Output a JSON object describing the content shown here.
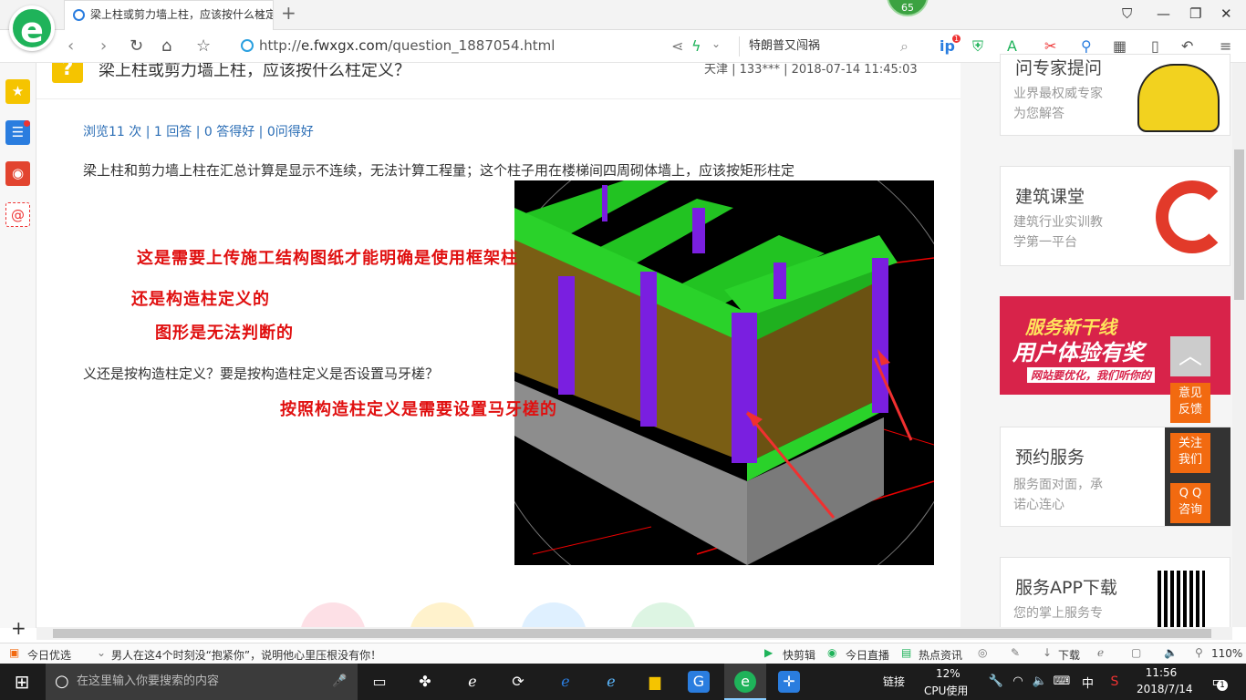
{
  "browser": {
    "tab_title": "梁上柱或剪力墙上柱，应该按什么柱定义？",
    "url_prefix": "http://",
    "url_domain": "e.fwxgx.com",
    "url_path": "/question_1887054.html",
    "search_text": "特朗普又闯祸",
    "badge_count": "65",
    "ext_badge": "1",
    "logo": "e"
  },
  "question": {
    "title": "梁上柱或剪力墙上柱，应该按什么柱定义？",
    "meta": "天津 | 133*** | 2018-07-14 11:45:03",
    "stats": "浏览11 次 | 1 回答 | 0 答得好 | 0问得好",
    "body_line1": "梁上柱和剪力墙上柱在汇总计算是显示不连续，无法计算工程量；这个柱子用在楼梯间四周砌体墙上，应该按矩形柱定",
    "body_line2": "义还是按构造柱定义？要是按构造柱定义是否设置马牙槎？"
  },
  "annotations": {
    "a1": "这是需要上传施工结构图纸才能明确是使用框架柱",
    "a2": "还是构造柱定义的",
    "a3": "图形是无法判断的",
    "a4": "按照构造柱定义是需要设置马牙槎的"
  },
  "sidebar": {
    "card0_title": "问专家提问",
    "card0_sub1": "业界最权威专家",
    "card0_sub2": "为您解答",
    "card1_title": "建筑课堂",
    "card1_sub1": "建筑行业实训教",
    "card1_sub2": "学第一平台",
    "banner_line1": "服务新干线",
    "banner_line2": "用户体验有奖",
    "banner_line3": "网站要优化，我们听你的",
    "card2_title": "预约服务",
    "card2_sub1": "服务面对面，承",
    "card2_sub2": "诺心连心",
    "card3_title": "服务APP下载",
    "card3_sub1": "您的掌上服务专"
  },
  "float_buttons": {
    "feedback": "意见\n反馈",
    "follow": "关注\n我们",
    "qq": "Q Q\n咨询"
  },
  "statusbar": {
    "today": "今日优选",
    "news": "男人在这4个时刻没“抱紧你”，说明他心里压根没有你！",
    "kuaijian": "快剪辑",
    "live": "今日直播",
    "hot": "热点资讯",
    "download": "下载",
    "zoom": "110%"
  },
  "taskbar": {
    "search_placeholder": "在这里输入你要搜索的内容",
    "link": "链接",
    "cpu_pct": "12%",
    "cpu_label": "CPU使用",
    "ime": "中",
    "time": "11:56",
    "date": "2018/7/14",
    "notif": "1"
  },
  "colors": {
    "green": "#1fb35a",
    "orange": "#f26a10",
    "red": "#e01010",
    "link": "#2a6db5"
  }
}
